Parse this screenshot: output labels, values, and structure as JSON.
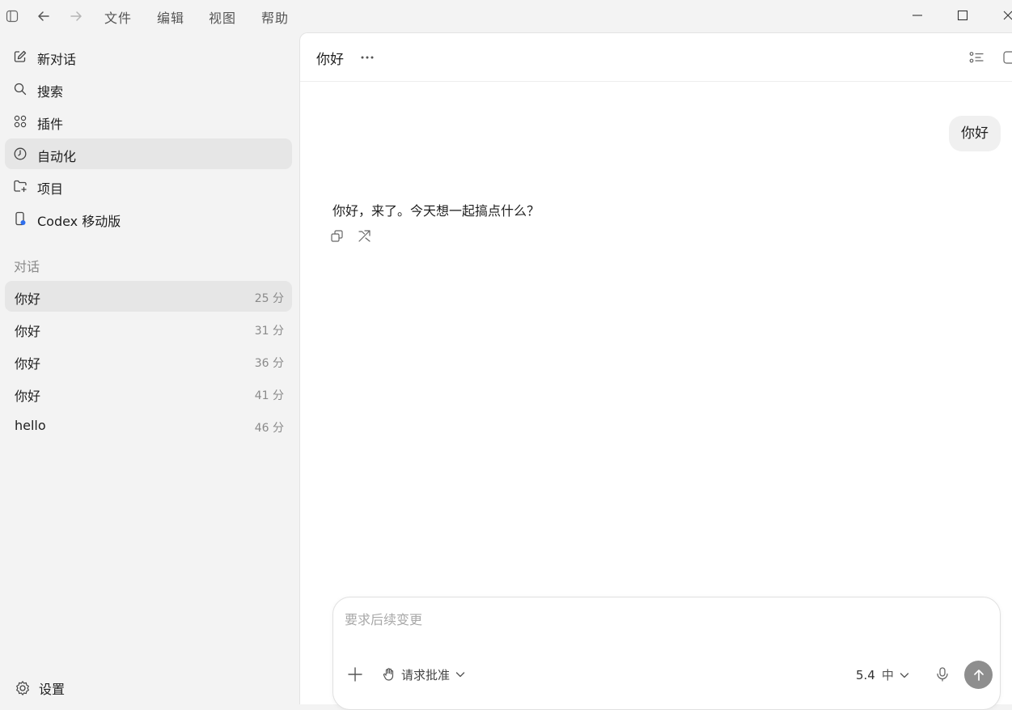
{
  "menu": {
    "items": [
      "文件",
      "编辑",
      "视图",
      "帮助"
    ]
  },
  "sidebar": {
    "nav": [
      {
        "label": "新对话",
        "icon": "edit-icon"
      },
      {
        "label": "搜索",
        "icon": "search-icon"
      },
      {
        "label": "插件",
        "icon": "plugins-grid-icon"
      },
      {
        "label": "自动化",
        "icon": "clock-icon",
        "active": true
      },
      {
        "label": "项目",
        "icon": "folder-add-icon"
      },
      {
        "label": "Codex 移动版",
        "icon": "mobile-phone-icon"
      }
    ],
    "section_title": "对话",
    "conversations": [
      {
        "title": "你好",
        "time": "25 分",
        "active": true
      },
      {
        "title": "你好",
        "time": "31 分"
      },
      {
        "title": "你好",
        "time": "36 分"
      },
      {
        "title": "你好",
        "time": "41 分"
      },
      {
        "title": "hello",
        "time": "46 分"
      }
    ],
    "settings_label": "设置"
  },
  "chat": {
    "title": "你好",
    "user_message": "你好",
    "assistant_message": "你好，来了。今天想一起搞点什么？"
  },
  "composer": {
    "placeholder": "要求后续变更",
    "approval_label": "请求批准",
    "model_version": "5.4",
    "effort": "中"
  }
}
